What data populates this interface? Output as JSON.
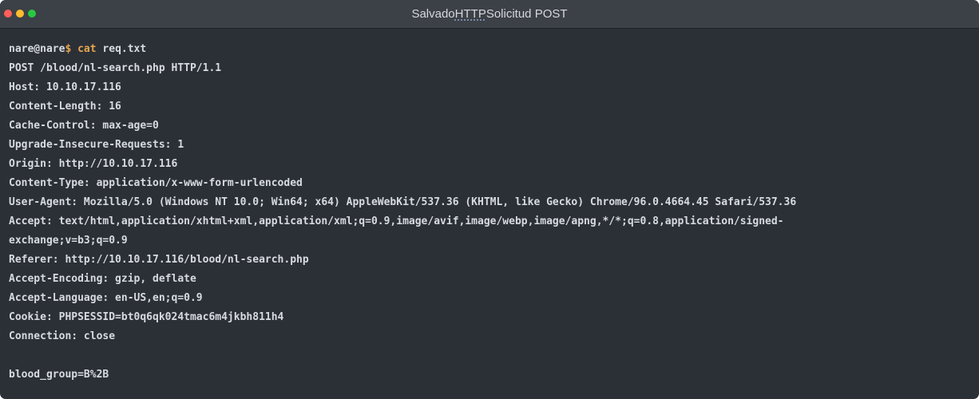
{
  "window": {
    "title_part1": "Salvado",
    "title_part2": "HTTP",
    "title_part3": "Solicitud POST"
  },
  "terminal": {
    "prompt_user": "nare@nare",
    "prompt_symbol": "$",
    "command": "cat",
    "command_arg": "req.txt",
    "lines": [
      "POST /blood/nl-search.php HTTP/1.1",
      "Host: 10.10.17.116",
      "Content-Length: 16",
      "Cache-Control: max-age=0",
      "Upgrade-Insecure-Requests: 1",
      "Origin: http://10.10.17.116",
      "Content-Type: application/x-www-form-urlencoded",
      "User-Agent: Mozilla/5.0 (Windows NT 10.0; Win64; x64) AppleWebKit/537.36 (KHTML, like Gecko) Chrome/96.0.4664.45 Safari/537.36",
      "Accept: text/html,application/xhtml+xml,application/xml;q=0.9,image/avif,image/webp,image/apng,*/*;q=0.8,application/signed-",
      "exchange;v=b3;q=0.9",
      "Referer: http://10.10.17.116/blood/nl-search.php",
      "Accept-Encoding: gzip, deflate",
      "Accept-Language: en-US,en;q=0.9",
      "Cookie: PHPSESSID=bt0q6qk024tmac6m4jkbh811h4",
      "Connection: close",
      "",
      "blood_group=B%2B"
    ]
  }
}
